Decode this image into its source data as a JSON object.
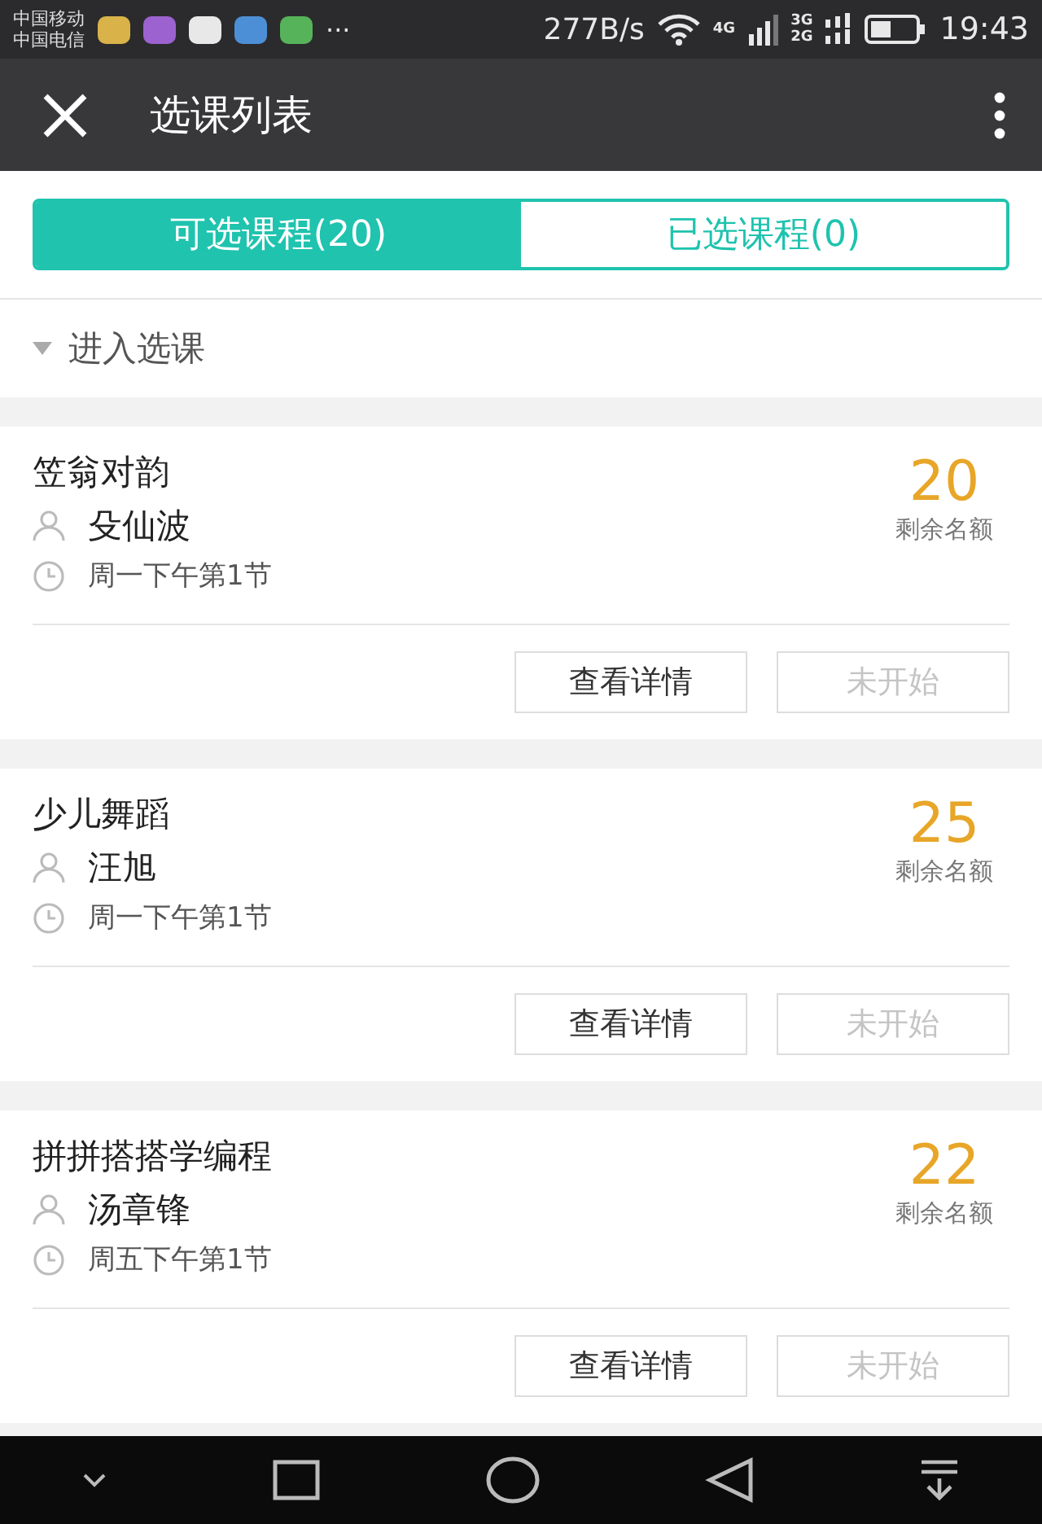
{
  "status_bar": {
    "carriers": [
      "中国移动",
      "中国电信"
    ],
    "more": "···",
    "speed": "277B/s",
    "network_4g": "4G",
    "network_3g": "3G",
    "network_2g": "2G",
    "time": "19:43"
  },
  "header": {
    "title": "选课列表"
  },
  "tabs": [
    {
      "label": "可选课程(20)",
      "selected": true
    },
    {
      "label": "已选课程(0)",
      "selected": false
    }
  ],
  "section": {
    "label": "进入选课",
    "expanded": false
  },
  "courses": [
    {
      "name": "笠翁对韵",
      "teacher": "殳仙波",
      "time": "周一下午第1节",
      "remaining": "20",
      "remaining_label": "剩余名额",
      "buttons": [
        {
          "label": "查看详情",
          "disabled": false
        },
        {
          "label": "未开始",
          "disabled": true
        }
      ]
    },
    {
      "name": "少儿舞蹈",
      "teacher": "汪旭",
      "time": "周一下午第1节",
      "remaining": "25",
      "remaining_label": "剩余名额",
      "buttons": [
        {
          "label": "查看详情",
          "disabled": false
        },
        {
          "label": "未开始",
          "disabled": true
        }
      ]
    },
    {
      "name": "拼拼搭搭学编程",
      "teacher": "汤章锋",
      "time": "周五下午第1节",
      "remaining": "22",
      "remaining_label": "剩余名额",
      "buttons": [
        {
          "label": "查看详情",
          "disabled": false
        },
        {
          "label": "未开始",
          "disabled": true
        }
      ]
    }
  ]
}
